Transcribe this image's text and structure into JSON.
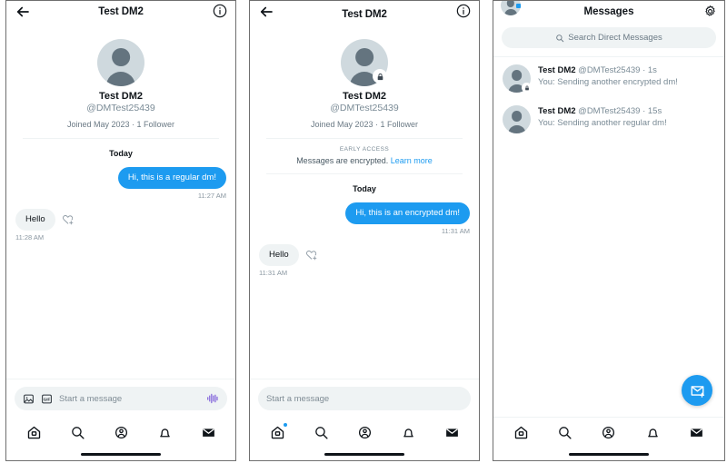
{
  "panels": {
    "regular_dm": {
      "header": {
        "title": "Test DM2",
        "back_icon": "back-arrow-icon",
        "info_icon": "info-circle-icon"
      },
      "profile": {
        "name": "Test DM2",
        "handle": "@DMTest25439",
        "meta": "Joined May 2023 · 1 Follower",
        "encrypted": false
      },
      "day_separator": "Today",
      "messages": [
        {
          "direction": "outgoing",
          "text": "Hi, this is a regular dm!",
          "time": "11:27 AM",
          "reaction_icon": null
        },
        {
          "direction": "incoming",
          "text": "Hello",
          "time": "11:28 AM",
          "reaction_icon": "heart-plus-icon"
        }
      ],
      "composer": {
        "placeholder": "Start a message",
        "image_icon": "image-icon",
        "gif_icon": "gif-icon",
        "audio_icon": "audio-waveform-icon"
      },
      "nav": {
        "home_badge": false,
        "items": [
          {
            "icon": "home-icon",
            "label": "Home"
          },
          {
            "icon": "search-icon",
            "label": "Search"
          },
          {
            "icon": "communities-icon",
            "label": "Communities"
          },
          {
            "icon": "bell-icon",
            "label": "Notifications"
          },
          {
            "icon": "messages-icon",
            "label": "Messages",
            "active": true
          }
        ]
      }
    },
    "encrypted_dm": {
      "header": {
        "title": "Test DM2",
        "back_icon": "back-arrow-icon",
        "info_icon": "info-circle-icon"
      },
      "profile": {
        "name": "Test DM2",
        "handle": "@DMTest25439",
        "meta": "Joined May 2023 · 1 Follower",
        "encrypted": true,
        "lock_icon": "lock-icon"
      },
      "early_access": {
        "label": "EARLY ACCESS",
        "text": "Messages are encrypted.",
        "link": "Learn more",
        "link_color": "#1d9bf0"
      },
      "day_separator": "Today",
      "messages": [
        {
          "direction": "outgoing",
          "text": "Hi, this is an encrypted dm!",
          "time": "11:31 AM",
          "reaction_icon": null
        },
        {
          "direction": "incoming",
          "text": "Hello",
          "time": "11:31 AM",
          "reaction_icon": "heart-plus-icon"
        }
      ],
      "composer": {
        "placeholder": "Start a message"
      },
      "nav": {
        "home_badge": true,
        "items": [
          {
            "icon": "home-icon",
            "label": "Home"
          },
          {
            "icon": "search-icon",
            "label": "Search"
          },
          {
            "icon": "communities-icon",
            "label": "Communities"
          },
          {
            "icon": "bell-icon",
            "label": "Notifications"
          },
          {
            "icon": "messages-icon",
            "label": "Messages",
            "active": true
          }
        ]
      }
    },
    "inbox": {
      "header": {
        "title": "Messages",
        "avatar_icon": "profile-avatar",
        "settings_icon": "gear-icon"
      },
      "search": {
        "placeholder": "Search Direct Messages",
        "icon": "search-icon"
      },
      "conversations": [
        {
          "name": "Test DM2",
          "handle": "@DMTest25439",
          "separator": "·",
          "time": "1s",
          "preview": "You: Sending another encrypted dm!",
          "encrypted": true,
          "lock_icon": "lock-icon"
        },
        {
          "name": "Test DM2",
          "handle": "@DMTest25439",
          "separator": "·",
          "time": "15s",
          "preview": "You: Sending another regular dm!",
          "encrypted": false
        }
      ],
      "compose_fab": {
        "icon": "new-message-icon",
        "color": "#1d9bf0"
      },
      "nav": {
        "items": [
          {
            "icon": "home-icon",
            "label": "Home"
          },
          {
            "icon": "search-icon",
            "label": "Search"
          },
          {
            "icon": "communities-icon",
            "label": "Communities"
          },
          {
            "icon": "bell-icon",
            "label": "Notifications"
          },
          {
            "icon": "messages-icon",
            "label": "Messages",
            "active": true
          }
        ]
      }
    }
  },
  "theme": {
    "accent": "#1d9bf0",
    "bubble_incoming": "#eff3f4",
    "text_primary": "#0f1419",
    "text_secondary": "#7a8b96",
    "audio_icon_color": "#7856d8"
  }
}
